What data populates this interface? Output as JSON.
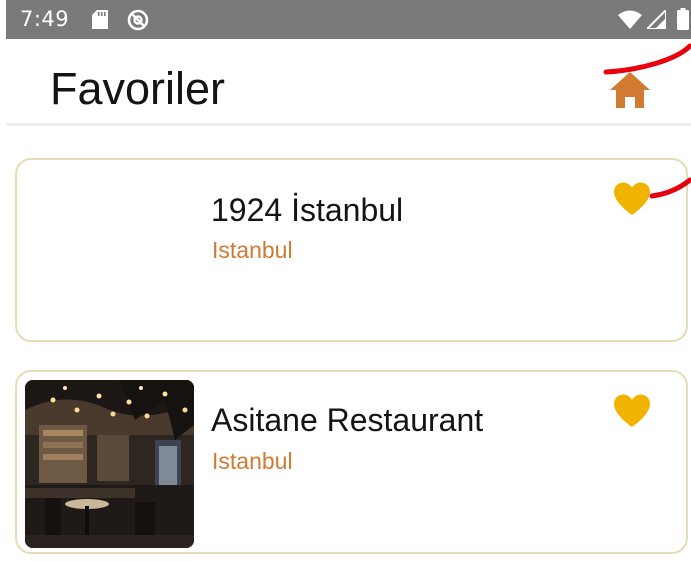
{
  "status_bar": {
    "time": "7:49",
    "icons": [
      "sd-card-icon",
      "sync-disabled-icon",
      "wifi-icon",
      "signal-icon",
      "battery-icon"
    ]
  },
  "header": {
    "title": "Favoriler",
    "home_icon": "home-icon"
  },
  "favorites": [
    {
      "name": "1924 İstanbul",
      "city": "Istanbul",
      "favorited": true,
      "has_image": false
    },
    {
      "name": "Asitane Restaurant",
      "city": "Istanbul",
      "favorited": true,
      "has_image": true
    }
  ],
  "colors": {
    "status_bar": "#7a7a7a",
    "accent_orange": "#d07a32",
    "heart": "#f0b400",
    "card_border": "#e7dcb6",
    "annotation": "#e8000d"
  }
}
